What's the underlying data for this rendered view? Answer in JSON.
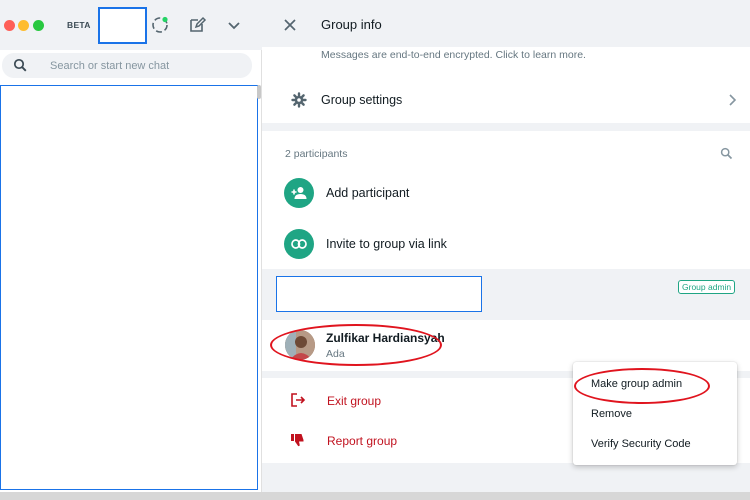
{
  "sidebar": {
    "beta_label": "BETA",
    "search": {
      "placeholder": "Search or start new chat",
      "value": ""
    },
    "icons": {
      "status": "status-icon",
      "new_chat": "new-chat-icon",
      "menu": "chevron-down-icon",
      "search": "search-icon"
    }
  },
  "group_info": {
    "title": "Group info",
    "encryption_notice": "Messages are end-to-end encrypted. Click to learn more.",
    "settings_label": "Group settings",
    "participants_count": "2 participants",
    "add_participant_label": "Add participant",
    "invite_label": "Invite to group via link",
    "admin_badge": "Group admin",
    "member": {
      "name": "Zulfikar Hardiansyah",
      "status": "Ada"
    },
    "exit_label": "Exit group",
    "report_label": "Report group"
  },
  "context_menu": {
    "items": [
      {
        "label": "Make group admin"
      },
      {
        "label": "Remove"
      },
      {
        "label": "Verify Security Code"
      }
    ]
  },
  "colors": {
    "accent_green": "#1fa584",
    "danger_red": "#c1121f",
    "highlight_red": "#e0141e",
    "selection_blue": "#1a73e8",
    "panel_grey": "#f0f2f5"
  }
}
